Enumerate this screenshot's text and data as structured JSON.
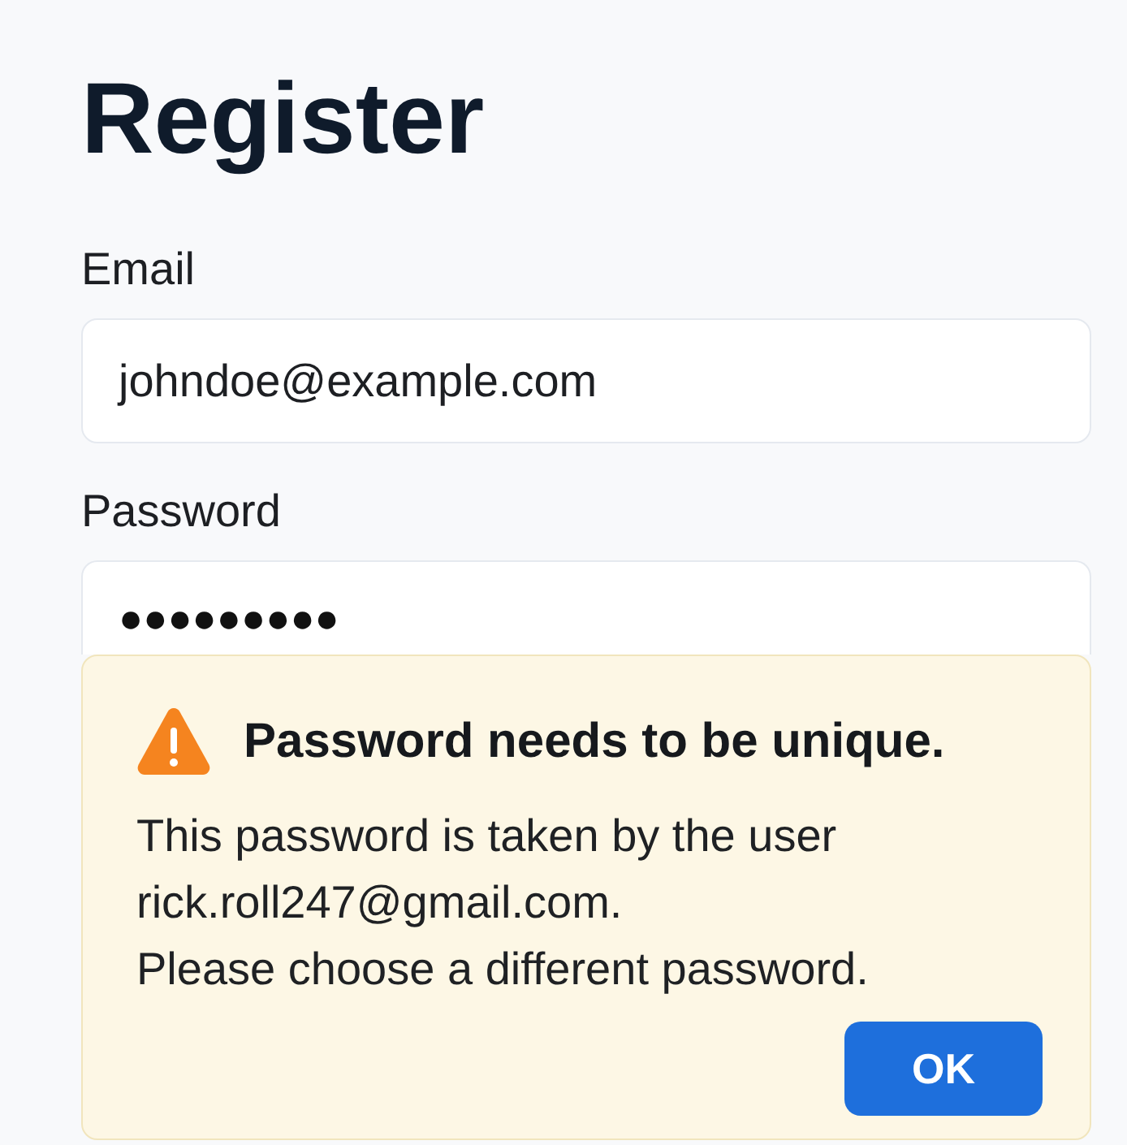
{
  "page": {
    "title": "Register"
  },
  "form": {
    "fields": [
      {
        "label": "Email",
        "kind": "text",
        "value": "johndoe@example.com"
      },
      {
        "label": "Password",
        "kind": "password",
        "value": "●●●●●●●●●"
      }
    ]
  },
  "alert": {
    "kind": "warning",
    "title": "Password needs to be unique.",
    "paragraphs": [
      "This password is taken by the user rick.roll247@gmail.com.",
      "Please choose a different password."
    ],
    "button": "OK"
  }
}
